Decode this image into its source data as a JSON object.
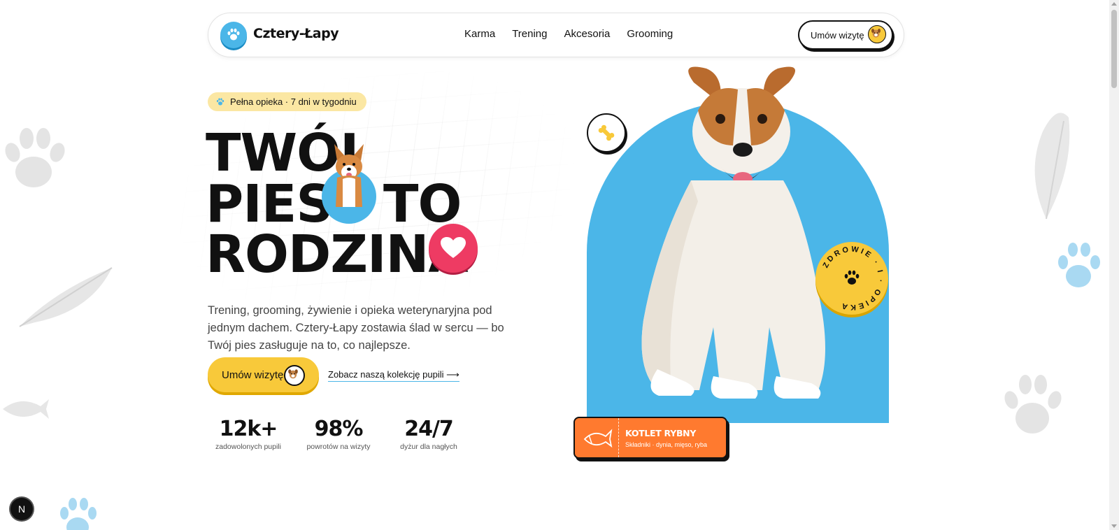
{
  "header": {
    "logo_text": "Cztery-Łapy",
    "nav": [
      "Karma",
      "Trening",
      "Akcesoria",
      "Grooming"
    ],
    "cta_label": "Umów wizytę"
  },
  "hero": {
    "pill": "Pełna opieka · 7 dni w tygodniu",
    "headline": {
      "line1": "TWÓJ",
      "line2": "PIES",
      "line2b": "TO",
      "line3": "RODZINA"
    },
    "description": "Trening, grooming, żywienie i opieka weterynaryjna pod jednym dachem. Cztery-Łapy zostawia ślad w sercu — bo Twój pies zasługuje na to, co najlepsze.",
    "primary_cta": "Umów wizytę",
    "secondary_link": "Zobacz naszą kolekcję pupili",
    "secondary_arrow": "⟶",
    "stats": [
      {
        "value": "12k+",
        "caption": "zadowolonych pupili"
      },
      {
        "value": "98%",
        "caption": "powrotów na wizyty"
      },
      {
        "value": "24/7",
        "caption": "dyżur dla nagłych"
      }
    ]
  },
  "visual": {
    "seal_text": "ZDROWIE · I · OPIEKA",
    "card_title": "KOTLET RYBNY",
    "card_subtitle": "Składniki · dynia, mięso, ryba"
  },
  "dev_badge": "N",
  "colors": {
    "accent_blue": "#4bb6e8",
    "accent_yellow": "#f8c93a",
    "accent_pink": "#ee3b63",
    "accent_orange": "#ff7a2f",
    "pill_bg": "#fbe7a3"
  }
}
